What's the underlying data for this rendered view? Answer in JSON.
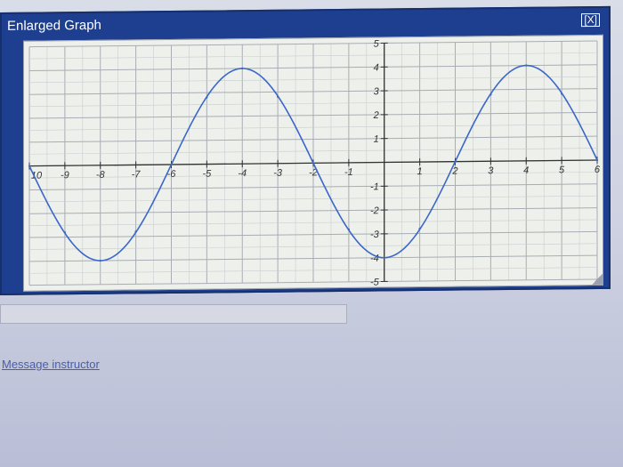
{
  "window": {
    "title": "Enlarged Graph",
    "close_label": "[X]"
  },
  "footer": {
    "message_link": "Message instructor"
  },
  "colors": {
    "curve": "#3a67c9",
    "title_bar": "#1e3f8f",
    "grid_minor": "#c9cdd0",
    "grid_major": "#a7adb3"
  },
  "chart_data": {
    "type": "line",
    "title": "",
    "xlabel": "",
    "ylabel": "",
    "xlim": [
      -10,
      6
    ],
    "ylim": [
      -5,
      5
    ],
    "grid": true,
    "x_ticks": [
      -10,
      -9,
      -8,
      -7,
      -6,
      -5,
      -4,
      -3,
      -2,
      -1,
      1,
      2,
      3,
      4,
      5,
      6
    ],
    "x_tick_labels": [
      "10",
      "-9",
      "-8",
      "-7",
      "-6",
      "-5",
      "-4",
      "-3",
      "-2",
      "-1",
      "1",
      "2",
      "3",
      "4",
      "5",
      "6"
    ],
    "y_ticks": [
      5,
      4,
      3,
      2,
      1,
      -1,
      -2,
      -3,
      -4,
      -5
    ],
    "y_tick_labels": [
      "5",
      "4",
      "3",
      "2",
      "1",
      "-1",
      "-2",
      "-3",
      "-4",
      "-5"
    ],
    "series": [
      {
        "x": [
          -10,
          -9,
          -8,
          -7,
          -6,
          -5,
          -4,
          -3,
          -2,
          -1,
          0,
          1,
          2,
          3,
          4,
          5,
          6
        ],
        "y": [
          0,
          -2.8,
          -4,
          -2.8,
          0,
          2.8,
          4,
          2.8,
          0,
          -2.8,
          -4,
          -2.8,
          0,
          2.8,
          4,
          2.8,
          0
        ]
      }
    ]
  }
}
